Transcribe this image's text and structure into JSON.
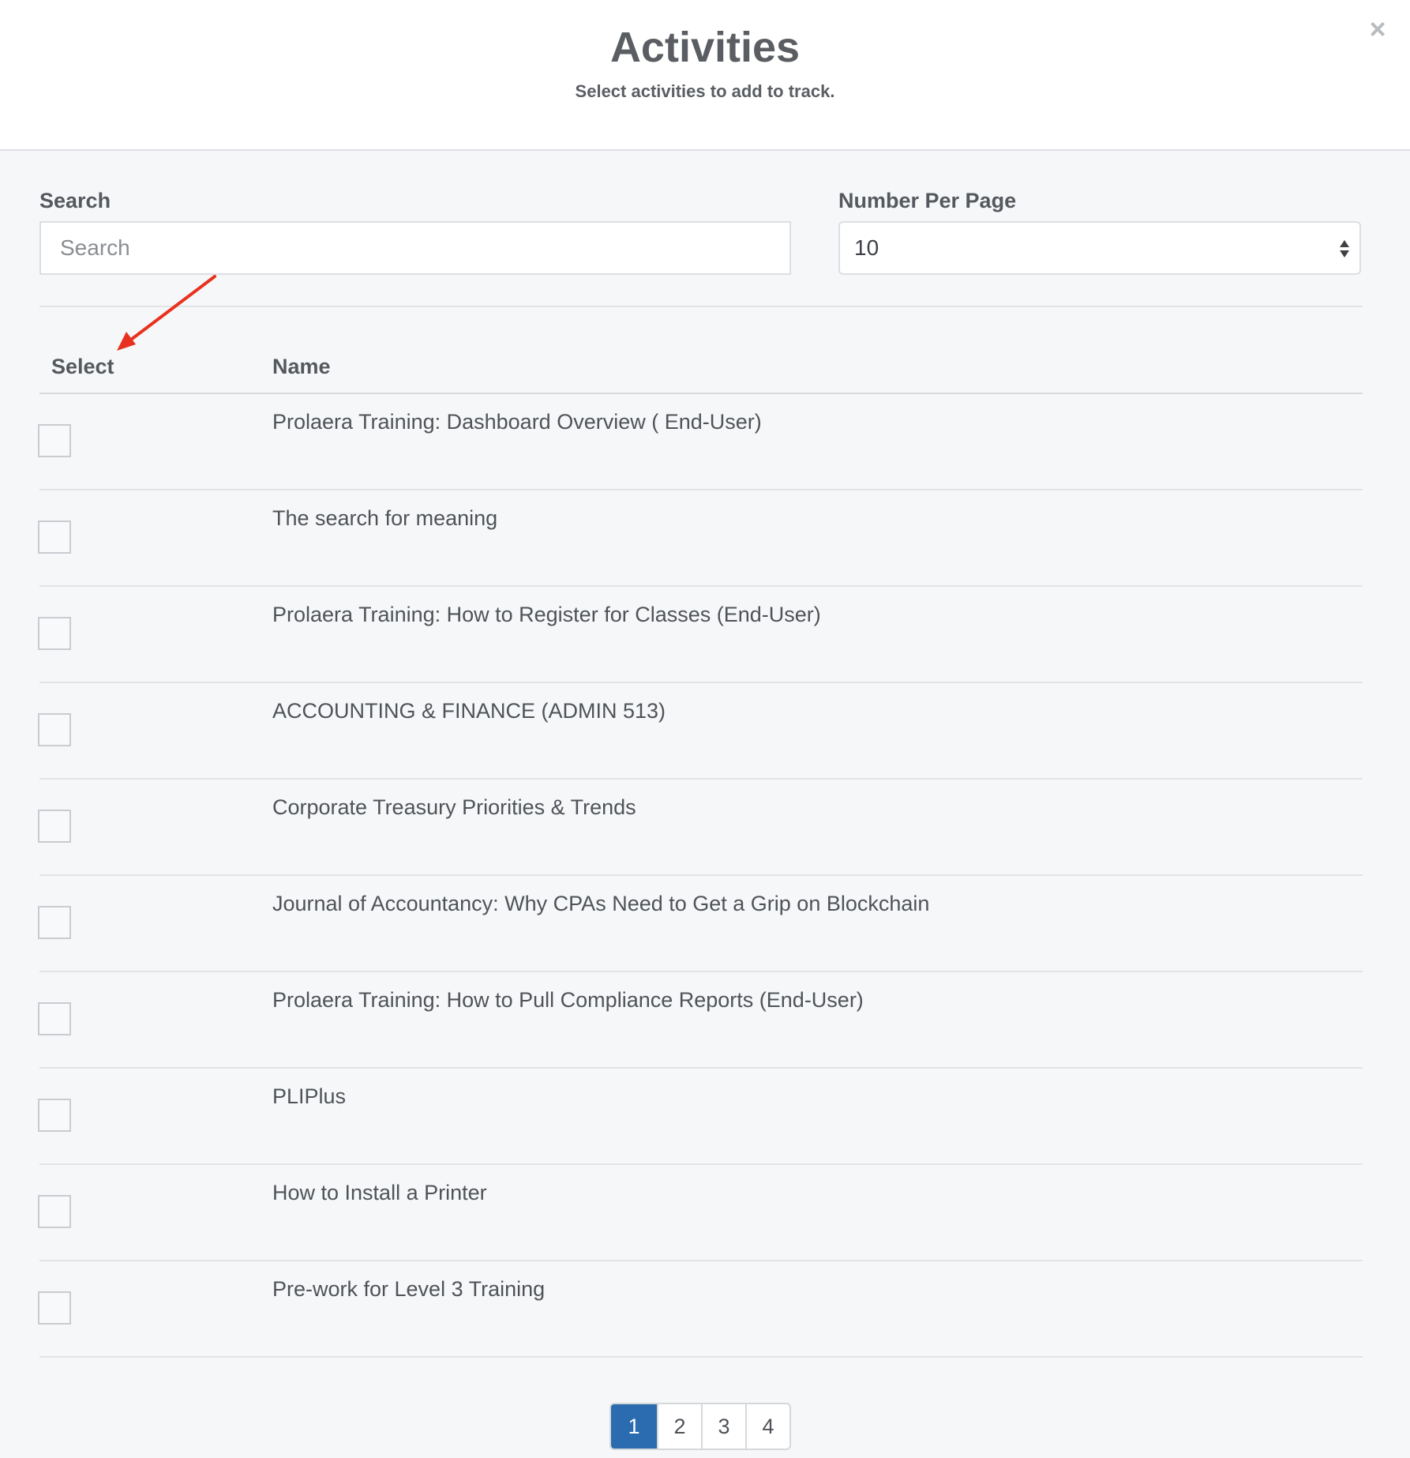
{
  "modal": {
    "title": "Activities",
    "subtitle": "Select activities to add to track.",
    "close_glyph": "×"
  },
  "search": {
    "label": "Search",
    "placeholder": "Search",
    "value": ""
  },
  "per_page": {
    "label": "Number Per Page",
    "selected": "10"
  },
  "table": {
    "columns": [
      "Select",
      "Name"
    ],
    "rows": [
      {
        "name": "Prolaera Training: Dashboard Overview ( End-User)",
        "checked": false
      },
      {
        "name": "The search for meaning",
        "checked": false
      },
      {
        "name": "Prolaera Training: How to Register for Classes (End-User)",
        "checked": false
      },
      {
        "name": "ACCOUNTING & FINANCE (ADMIN 513)",
        "checked": false
      },
      {
        "name": "Corporate Treasury Priorities & Trends",
        "checked": false
      },
      {
        "name": "Journal of Accountancy: Why CPAs Need to Get a Grip on Blockchain",
        "checked": false
      },
      {
        "name": "Prolaera Training: How to Pull Compliance Reports (End-User)",
        "checked": false
      },
      {
        "name": "PLIPlus",
        "checked": false
      },
      {
        "name": "How to Install a Printer",
        "checked": false
      },
      {
        "name": "Pre-work for Level 3 Training",
        "checked": false
      }
    ]
  },
  "pagination": {
    "pages": [
      "1",
      "2",
      "3",
      "4"
    ],
    "active": "1"
  },
  "colors": {
    "accent": "#2b6cb0",
    "annotation_arrow": "#e8321f"
  },
  "icons": {
    "close": "close-icon",
    "select_arrows": "sort-arrows-icon",
    "annotation": "arrow-annotation"
  }
}
